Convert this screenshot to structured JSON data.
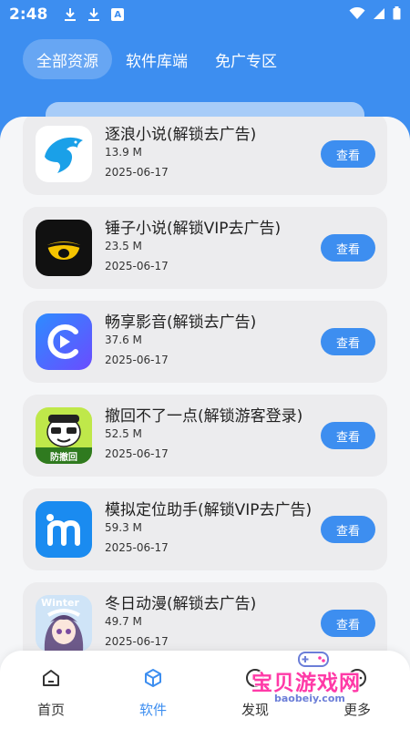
{
  "status_bar": {
    "time": "2:48",
    "badge": "A"
  },
  "tabs": [
    {
      "label": "全部资源",
      "active": true
    },
    {
      "label": "软件库端",
      "active": false
    },
    {
      "label": "免广专区",
      "active": false
    }
  ],
  "apps": [
    {
      "title": "逐浪小说(解锁去广告)",
      "size": "13.9 M",
      "date": "2025-06-17",
      "icon": "dolphin-icon"
    },
    {
      "title": "锤子小说(解锁VIP去广告)",
      "size": "23.5 M",
      "date": "2025-06-17",
      "icon": "eye-icon"
    },
    {
      "title": "畅享影音(解锁去广告)",
      "size": "37.6 M",
      "date": "2025-06-17",
      "icon": "play-c-icon"
    },
    {
      "title": "撤回不了一点(解锁游客登录)",
      "size": "52.5 M",
      "date": "2025-06-17",
      "icon": "cartoon-icon",
      "icon_text": "防撤回"
    },
    {
      "title": "模拟定位助手(解锁VIP去广告)",
      "size": "59.3 M",
      "date": "2025-06-17",
      "icon": "m-letter-icon"
    },
    {
      "title": "冬日动漫(解锁去广告)",
      "size": "49.7 M",
      "date": "2025-06-17",
      "icon": "anime-girl-icon",
      "icon_text": "Winter"
    }
  ],
  "view_button_label": "查看",
  "bottom_nav": [
    {
      "label": "首页",
      "icon": "home-icon"
    },
    {
      "label": "软件",
      "icon": "cube-icon",
      "active": true
    },
    {
      "label": "发现",
      "icon": "compass-icon"
    },
    {
      "label": "更多",
      "icon": "more-icon"
    }
  ],
  "watermark": {
    "text": "宝贝游戏网",
    "url": "baobeiy.com"
  },
  "colors": {
    "accent": "#3d8ef0",
    "card": "#ececee",
    "background": "#f5f6f8"
  }
}
